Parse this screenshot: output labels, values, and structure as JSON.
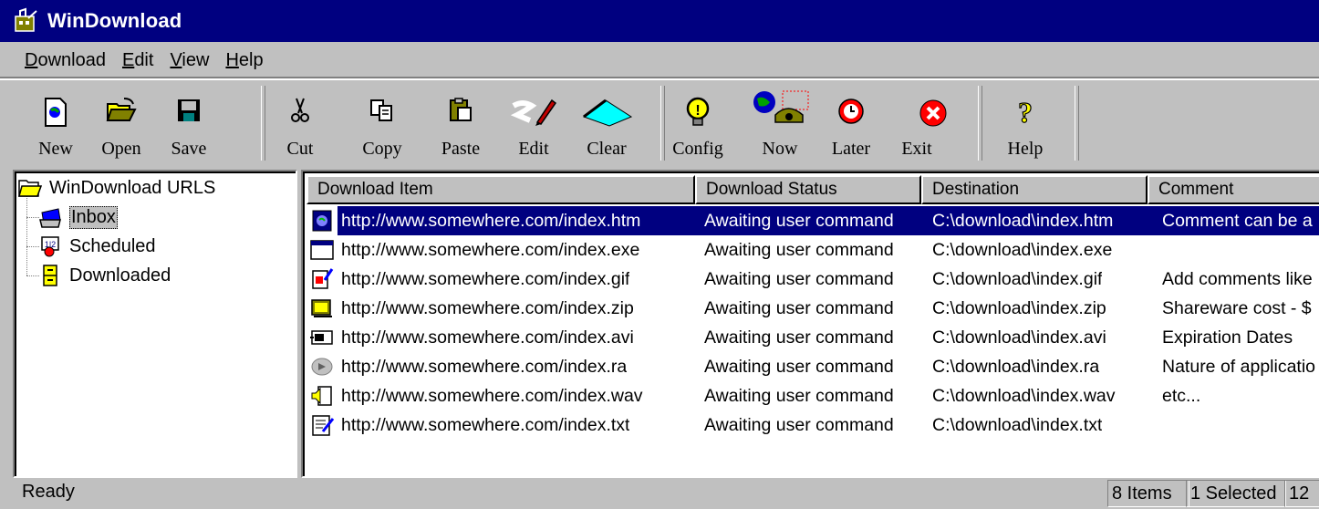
{
  "window": {
    "title": "WinDownload"
  },
  "menu": [
    {
      "accel": "D",
      "rest": "ownload"
    },
    {
      "accel": "E",
      "rest": "dit"
    },
    {
      "accel": "V",
      "rest": "iew"
    },
    {
      "accel": "H",
      "rest": "elp"
    }
  ],
  "toolbar": {
    "new": "New",
    "open": "Open",
    "save": "Save",
    "cut": "Cut",
    "copy": "Copy",
    "paste": "Paste",
    "edit": "Edit",
    "clear": "Clear",
    "config": "Config",
    "now": "Now",
    "later": "Later",
    "exit": "Exit",
    "help": "Help"
  },
  "tree": {
    "root": "WinDownload URLS",
    "items": [
      "Inbox",
      "Scheduled",
      "Downloaded"
    ],
    "selected": "Inbox"
  },
  "list": {
    "columns": [
      "Download Item",
      "Download Status",
      "Destination",
      "Comment"
    ],
    "rows": [
      {
        "icon": "html-document-icon",
        "item": "http://www.somewhere.com/index.htm",
        "status": "Awaiting user command",
        "dest": "C:\\download\\index.htm",
        "comment": "Comment can be a"
      },
      {
        "icon": "executable-icon",
        "item": "http://www.somewhere.com/index.exe",
        "status": "Awaiting user command",
        "dest": "C:\\download\\index.exe",
        "comment": ""
      },
      {
        "icon": "image-file-icon",
        "item": "http://www.somewhere.com/index.gif",
        "status": "Awaiting user command",
        "dest": "C:\\download\\index.gif",
        "comment": "Add comments like"
      },
      {
        "icon": "zip-archive-icon",
        "item": "http://www.somewhere.com/index.zip",
        "status": "Awaiting user command",
        "dest": "C:\\download\\index.zip",
        "comment": "Shareware cost - $"
      },
      {
        "icon": "video-file-icon",
        "item": "http://www.somewhere.com/index.avi",
        "status": "Awaiting user command",
        "dest": "C:\\download\\index.avi",
        "comment": "Expiration Dates"
      },
      {
        "icon": "realaudio-icon",
        "item": "http://www.somewhere.com/index.ra",
        "status": "Awaiting user command",
        "dest": "C:\\download\\index.ra",
        "comment": "Nature of applicatio"
      },
      {
        "icon": "wave-audio-icon",
        "item": "http://www.somewhere.com/index.wav",
        "status": "Awaiting user command",
        "dest": "C:\\download\\index.wav",
        "comment": "etc..."
      },
      {
        "icon": "text-file-icon",
        "item": "http://www.somewhere.com/index.txt",
        "status": "Awaiting user command",
        "dest": "C:\\download\\index.txt",
        "comment": ""
      }
    ]
  },
  "status": {
    "text": "Ready",
    "items_count": "8 Items",
    "selected_count": "1 Selected",
    "extra": "12"
  },
  "colors": {
    "selection": "#000080",
    "face": "#c0c0c0",
    "title_bar": "#000080"
  }
}
